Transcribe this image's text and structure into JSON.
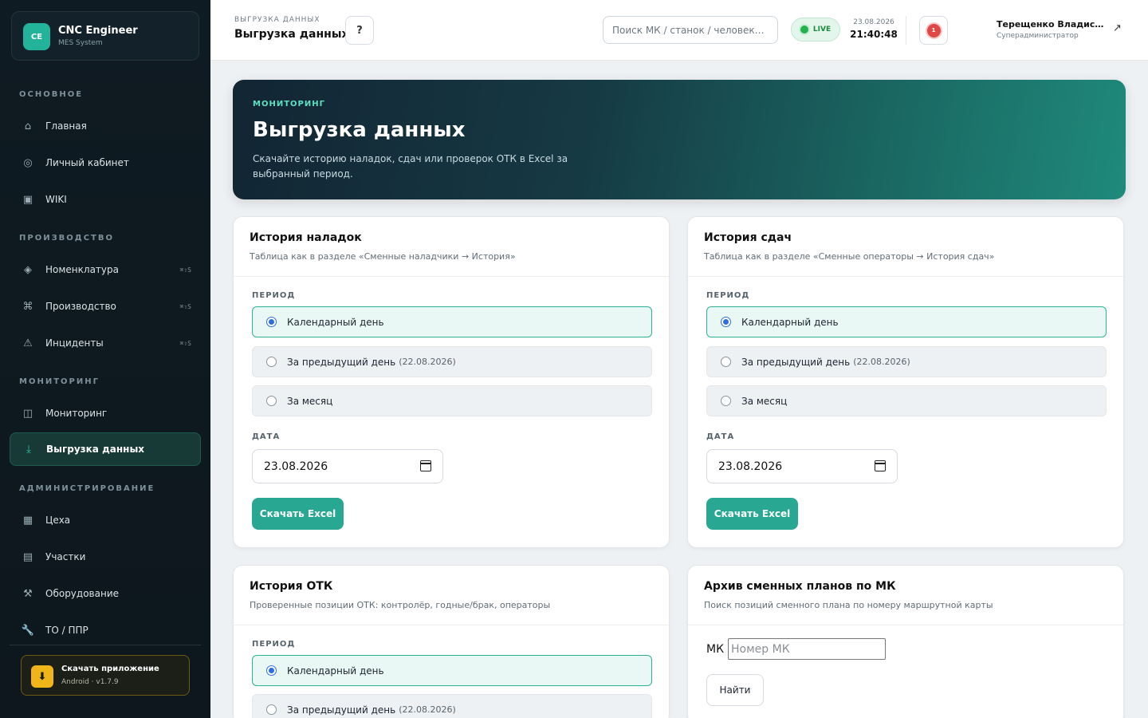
{
  "brand": {
    "logo": "CE",
    "title": "CNC Engineer",
    "subtitle": "MES System"
  },
  "sidebar": {
    "sections": [
      {
        "label": "ОСНОВНОЕ"
      },
      {
        "label": "ПРОИЗВОДСТВО"
      },
      {
        "label": "МОНИТОРИНГ"
      },
      {
        "label": "АДМИНИСТРИРОВАНИЕ"
      }
    ],
    "items": [
      {
        "label": "Главная",
        "icon": "home-icon",
        "glyph": "⌂"
      },
      {
        "label": "Личный кабинет",
        "icon": "profile-icon",
        "glyph": "◎"
      },
      {
        "label": "WIKI",
        "icon": "wiki-icon",
        "glyph": "▣"
      },
      {
        "label": "Номенклатура",
        "icon": "nomenclature-icon",
        "glyph": "◈",
        "shortcut": "⌘⇧S"
      },
      {
        "label": "Производство",
        "icon": "production-icon",
        "glyph": "⌘",
        "shortcut": "⌘⇧S"
      },
      {
        "label": "Инциденты",
        "icon": "incidents-icon",
        "glyph": "⚠",
        "shortcut": "⌘⇧S"
      },
      {
        "label": "Мониторинг",
        "icon": "monitoring-icon",
        "glyph": "◫"
      },
      {
        "label": "Выгрузка данных",
        "icon": "download-icon",
        "glyph": "⤓"
      },
      {
        "label": "Цеха",
        "icon": "workshops-icon",
        "glyph": "▦"
      },
      {
        "label": "Участки",
        "icon": "sections-icon",
        "glyph": "▤"
      },
      {
        "label": "Оборудование",
        "icon": "equipment-icon",
        "glyph": "⚒"
      },
      {
        "label": "ТО / ППР",
        "icon": "maintenance-icon",
        "glyph": "🔧"
      }
    ],
    "app": {
      "title": "Скачать приложение",
      "subtitle": "Android · v1.7.9",
      "icon": "download-app-icon",
      "glyph": "⬇"
    }
  },
  "topbar": {
    "breadcrumb": "ВЫГРУЗКА ДАННЫХ",
    "title": "Выгрузка данных",
    "help": "?",
    "search_placeholder": "Поиск МК / станок / человек…",
    "live": "LIVE",
    "date": "23.08.2026",
    "time": "21:40:48",
    "notifications": "1",
    "user_name": "Терещенко Владислав Владимирович",
    "user_role": "Суперадминистратор",
    "expand": "↗"
  },
  "hero": {
    "tag": "МОНИТОРИНГ",
    "title": "Выгрузка данных",
    "description": "Скачайте историю наладок, сдач или проверок ОТК в Excel за выбранный период."
  },
  "cards": {
    "setups": {
      "title": "История наладок",
      "subtitle": "Таблица как в разделе «Сменные наладчики → История»",
      "period_label": "ПЕРИОД",
      "options": [
        "Календарный день",
        "За предыдущий день",
        "За месяц"
      ],
      "prev_date": "(22.08.2026)",
      "date_label": "ДАТА",
      "date_value": "23.08.2026",
      "button": "Скачать Excel"
    },
    "handovers": {
      "title": "История сдач",
      "subtitle": "Таблица как в разделе «Сменные операторы → История сдач»",
      "period_label": "ПЕРИОД",
      "options": [
        "Календарный день",
        "За предыдущий день",
        "За месяц"
      ],
      "prev_date": "(22.08.2026)",
      "date_label": "ДАТА",
      "date_value": "23.08.2026",
      "button": "Скачать Excel"
    },
    "otk": {
      "title": "История ОТК",
      "subtitle": "Проверенные позиции ОТК: контролёр, годные/брак, операторы",
      "period_label": "ПЕРИОД",
      "options": [
        "Календарный день",
        "За предыдущий день"
      ],
      "prev_date": "(22.08.2026)"
    },
    "archive": {
      "title": "Архив сменных планов по МК",
      "subtitle": "Поиск позиций сменного плана по номеру маршрутной карты",
      "mk_label": "МК",
      "mk_placeholder": "Номер МК",
      "button": "Найти"
    }
  },
  "colors": {
    "accent": "#28a892",
    "sidebar_bg": "#0f1b22",
    "live_green": "#22b14c",
    "badge_red": "#e04848",
    "app_banner": "#f0b519"
  }
}
